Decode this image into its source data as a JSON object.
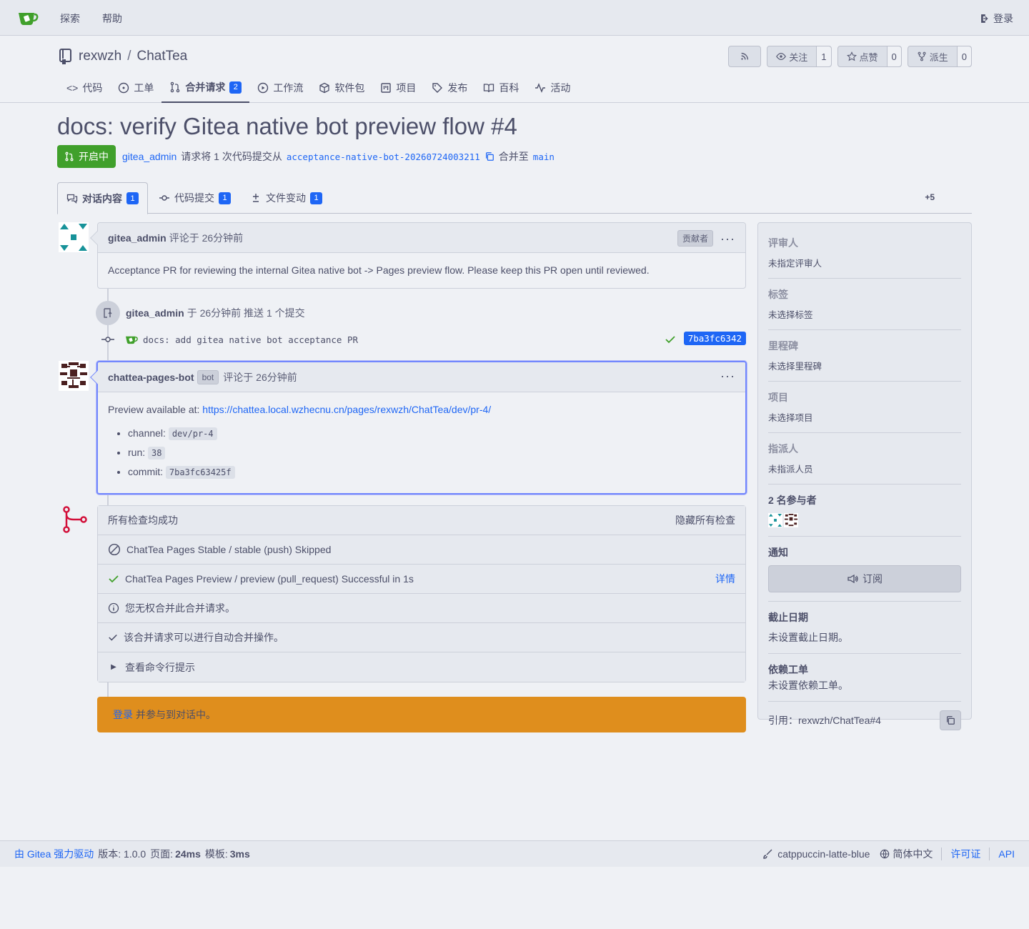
{
  "nav": {
    "explore": "探索",
    "help": "帮助",
    "login": "登录"
  },
  "repo": {
    "owner": "rexwzh",
    "separator": "/",
    "name": "ChatTea",
    "watch_label": "关注",
    "watch_count": "1",
    "star_label": "点赞",
    "star_count": "0",
    "fork_label": "派生",
    "fork_count": "0"
  },
  "tabs": [
    {
      "label": "代码"
    },
    {
      "label": "工单"
    },
    {
      "label": "合并请求",
      "badge": "2"
    },
    {
      "label": "工作流"
    },
    {
      "label": "软件包"
    },
    {
      "label": "项目"
    },
    {
      "label": "发布"
    },
    {
      "label": "百科"
    },
    {
      "label": "活动"
    }
  ],
  "pr": {
    "title": "docs: verify Gitea native bot preview flow #4",
    "state": "开启中",
    "author": "gitea_admin",
    "request_text": "请求将 1 次代码提交从",
    "head_branch": "acceptance-native-bot-20260724003211",
    "merge_into": "合并至",
    "base_branch": "main"
  },
  "pr_tabs": {
    "conversation": "对话内容",
    "conversation_count": "1",
    "commits": "代码提交",
    "commits_count": "1",
    "files": "文件变动",
    "files_count": "1",
    "diffstat": "+5"
  },
  "comment1": {
    "author": "gitea_admin",
    "meta": "评论于 26分钟前",
    "role": "贡献者",
    "body": "Acceptance PR for reviewing the internal Gitea native bot -> Pages preview flow. Please keep this PR open until reviewed."
  },
  "push": {
    "author": "gitea_admin",
    "text": "于 26分钟前 推送 1 个提交",
    "commit_message": "docs: add gitea native bot acceptance PR",
    "sha": "7ba3fc6342"
  },
  "comment2": {
    "author": "chattea-pages-bot",
    "bot_label": "bot",
    "meta": "评论于 26分钟前",
    "preview_prefix": "Preview available at:",
    "preview_url": "https://chattea.local.wzhecnu.cn/pages/rexwzh/ChatTea/dev/pr-4/",
    "items": [
      {
        "key": "channel:",
        "value": "dev/pr-4"
      },
      {
        "key": "run:",
        "value": "38"
      },
      {
        "key": "commit:",
        "value": "7ba3fc63425f"
      }
    ]
  },
  "checks": {
    "summary": "所有检查均成功",
    "hide": "隐藏所有检查",
    "stable": "ChatTea Pages Stable / stable (push) Skipped",
    "preview": "ChatTea Pages Preview / preview (pull_request) Successful in 1s",
    "details": "详情",
    "no_permission": "您无权合并此合并请求。",
    "auto_merge": "该合并请求可以进行自动合并操作。",
    "cli_hint": "查看命令行提示"
  },
  "login_banner": {
    "link": "登录",
    "text": "并参与到对话中。"
  },
  "sidebar": {
    "reviewers_title": "评审人",
    "reviewers_value": "未指定评审人",
    "labels_title": "标签",
    "labels_value": "未选择标签",
    "milestone_title": "里程碑",
    "milestone_value": "未选择里程碑",
    "projects_title": "项目",
    "projects_value": "未选择项目",
    "assignees_title": "指派人",
    "assignees_value": "未指派人员",
    "participants_title": "2 名参与者",
    "notifications_title": "通知",
    "subscribe": "订阅",
    "deadline_title": "截止日期",
    "deadline_value": "未设置截止日期。",
    "deps_title": "依赖工单",
    "deps_value": "未设置依赖工单。",
    "reference": "引用：rexwzh/ChatTea#4"
  },
  "footer": {
    "powered": "由 Gitea 强力驱动",
    "version": "版本: 1.0.0",
    "page_label": "页面:",
    "page_time": "24ms",
    "tmpl_label": "模板:",
    "tmpl_time": "3ms",
    "theme": "catppuccin-latte-blue",
    "language": "简体中文",
    "license": "许可证",
    "api": "API"
  }
}
